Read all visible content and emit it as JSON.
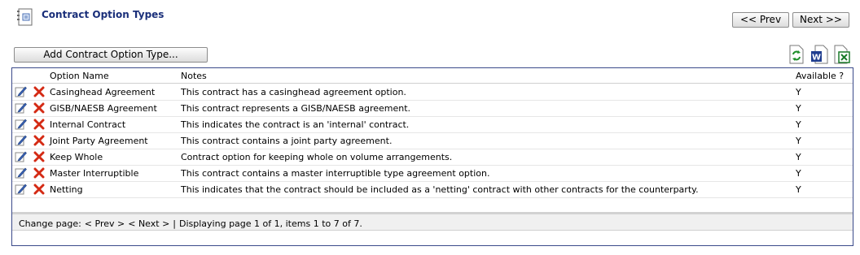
{
  "page": {
    "title": "Contract Option Types"
  },
  "nav": {
    "prev_label": "<< Prev",
    "next_label": "Next >>"
  },
  "toolbar": {
    "add_label": "Add Contract Option Type...",
    "refresh_icon": "refresh-icon",
    "word_icon": "word-export-icon",
    "excel_icon": "excel-export-icon"
  },
  "table": {
    "columns": {
      "name": "Option Name",
      "notes": "Notes",
      "available": "Available ?"
    },
    "rows": [
      {
        "name": "Casinghead Agreement",
        "notes": "This contract has a casinghead agreement option.",
        "available": "Y"
      },
      {
        "name": "GISB/NAESB Agreement",
        "notes": "This contract represents a GISB/NAESB agreement.",
        "available": "Y"
      },
      {
        "name": "Internal Contract",
        "notes": "This indicates the contract is an 'internal' contract.",
        "available": "Y"
      },
      {
        "name": "Joint Party Agreement",
        "notes": "This contract contains a joint party agreement.",
        "available": "Y"
      },
      {
        "name": "Keep Whole",
        "notes": "Contract option for keeping whole on volume arrangements.",
        "available": "Y"
      },
      {
        "name": "Master Interruptible",
        "notes": "This contract contains a master interruptible type agreement option.",
        "available": "Y"
      },
      {
        "name": "Netting",
        "notes": "This indicates that the contract should be included as a 'netting' contract with other contracts for the counterparty.",
        "available": "Y"
      }
    ]
  },
  "pager": {
    "label": "Change page:",
    "prev": "< Prev >",
    "next": "< Next >",
    "sep": "|",
    "status": "Displaying page 1 of 1, items 1 to 7 of 7."
  },
  "colors": {
    "title": "#1a2f7a",
    "grid_border": "#3b4a8a",
    "delete": "#d42a14"
  }
}
